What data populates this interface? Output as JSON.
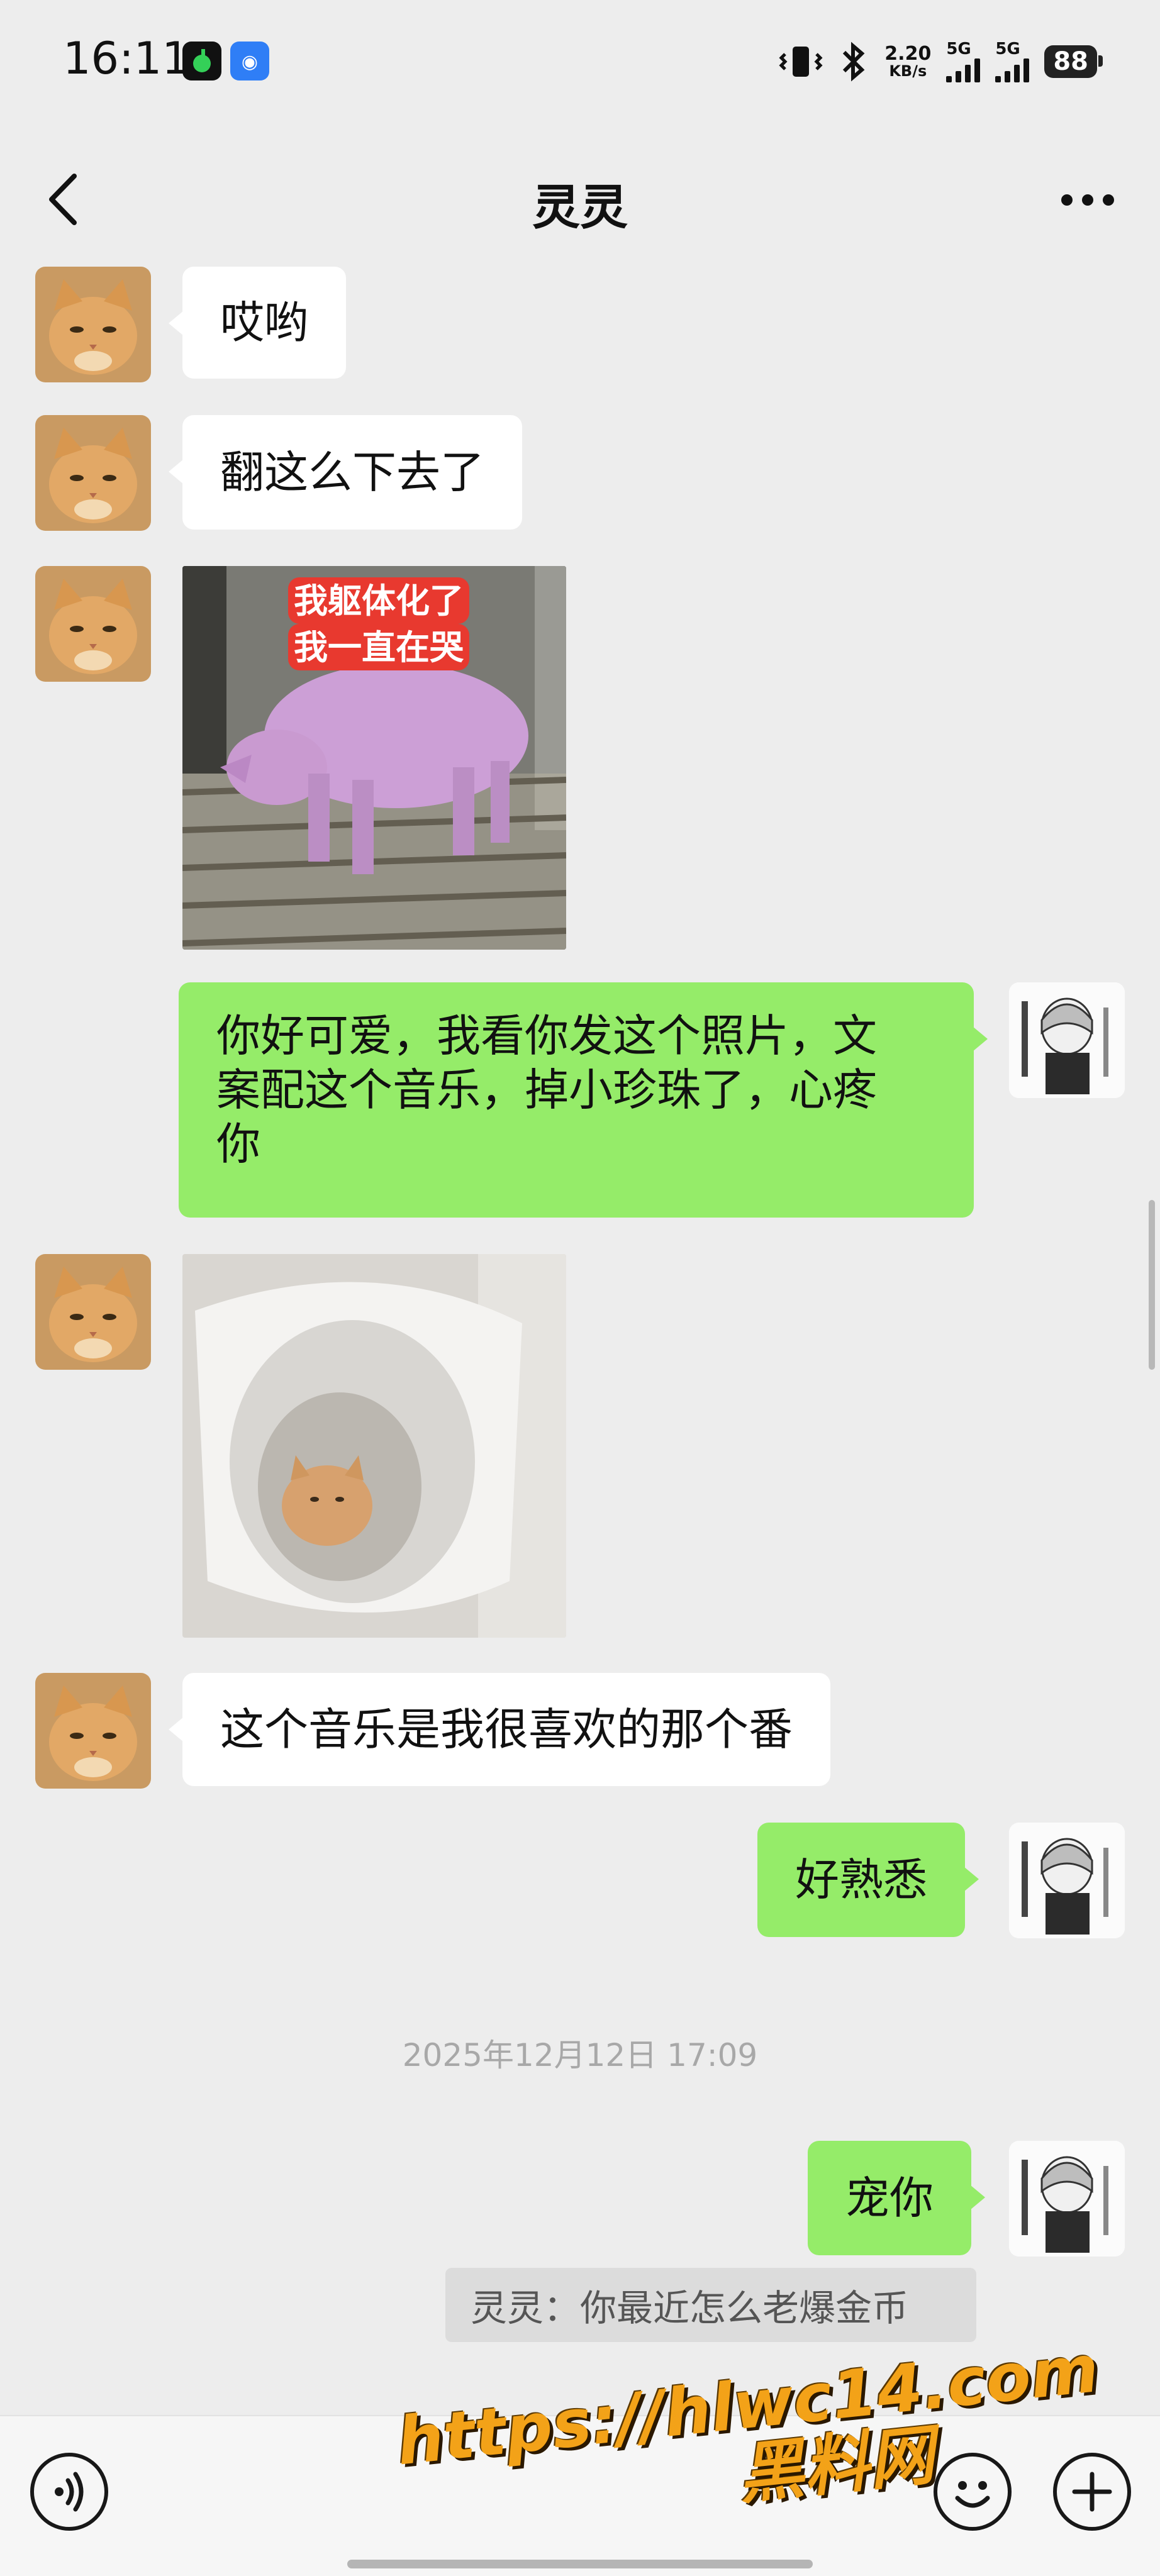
{
  "status_bar": {
    "time": "16:11",
    "speed_value": "2.20",
    "speed_unit": "KB/s",
    "signal1_label": "5G",
    "signal2_label": "5G",
    "battery": "88"
  },
  "header": {
    "title": "灵灵",
    "back_icon": "chevron-left-icon",
    "more_icon": "more-icon"
  },
  "messages": [
    {
      "side": "left",
      "type": "text",
      "text": "哎哟"
    },
    {
      "side": "left",
      "type": "text",
      "text": "翻这么下去了"
    },
    {
      "side": "left",
      "type": "image",
      "caption_line1": "我躯体化了",
      "caption_line2": "我一直在哭"
    },
    {
      "side": "right",
      "type": "text",
      "lines": [
        "你好可爱，我看你发这个照片，文",
        "案配这个音乐，掉小珍珠了，心疼",
        "你"
      ]
    },
    {
      "side": "left",
      "type": "image",
      "subject": "kitten-in-toilet"
    },
    {
      "side": "left",
      "type": "text",
      "text": "这个音乐是我很喜欢的那个番"
    },
    {
      "side": "right",
      "type": "text",
      "text": "好熟悉"
    },
    {
      "side": "right",
      "type": "text",
      "text": "宠你"
    }
  ],
  "timestamp": "2025年12月12日 17:09",
  "quote": "灵灵：你最近怎么老爆金币",
  "watermark": {
    "url": "https://hlwc14.com",
    "name": "黑料网"
  },
  "input_bar": {
    "voice_icon": "voice-icon",
    "emoji_icon": "emoji-icon",
    "plus_icon": "plus-icon"
  },
  "colors": {
    "background": "#ededed",
    "incoming_bubble": "#ffffff",
    "outgoing_bubble": "#95ec69",
    "watermark": "#f3a218"
  }
}
